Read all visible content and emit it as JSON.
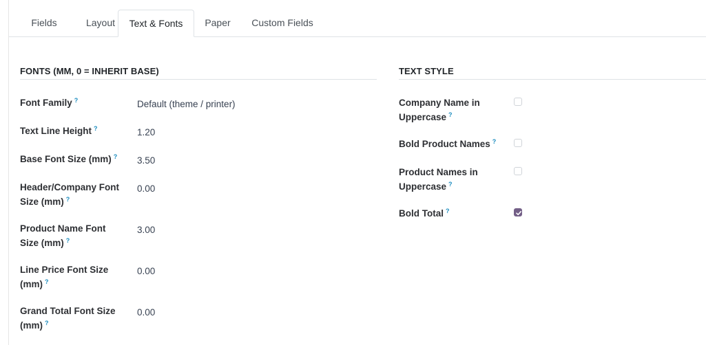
{
  "tabs": [
    {
      "label": "Fields"
    },
    {
      "label": "Layout"
    },
    {
      "label": "Text & Fonts"
    },
    {
      "label": "Paper"
    },
    {
      "label": "Custom Fields"
    }
  ],
  "active_tab": "Text & Fonts",
  "fonts_section": {
    "title": "FONTS (MM, 0 = INHERIT BASE)",
    "fields": [
      {
        "label": "Font Family",
        "value": "Default (theme / printer)"
      },
      {
        "label": "Text Line Height",
        "value": "1.20"
      },
      {
        "label": "Base Font Size (mm)",
        "value": "3.50"
      },
      {
        "label_line1": "Header/Company Font",
        "label_line2": "Size (mm)",
        "value": "0.00"
      },
      {
        "label_line1": "Product Name Font",
        "label_line2": "Size (mm)",
        "value": "3.00"
      },
      {
        "label_line1": "Line Price Font Size",
        "label_line2": "(mm)",
        "value": "0.00"
      },
      {
        "label_line1": "Grand Total Font Size",
        "label_line2": "(mm)",
        "value": "0.00"
      }
    ]
  },
  "text_style_section": {
    "title": "TEXT STYLE",
    "fields": [
      {
        "label_line1": "Company Name in",
        "label_line2": "Uppercase",
        "checked": false
      },
      {
        "label": "Bold Product Names",
        "checked": false
      },
      {
        "label_line1": "Product Names in",
        "label_line2": "Uppercase",
        "checked": false
      },
      {
        "label": "Bold Total",
        "checked": true
      }
    ]
  },
  "tooltip_marker": "?",
  "colors": {
    "accent": "#735f87",
    "tooltip": "#1b8cbf",
    "border": "#dee2e6"
  }
}
